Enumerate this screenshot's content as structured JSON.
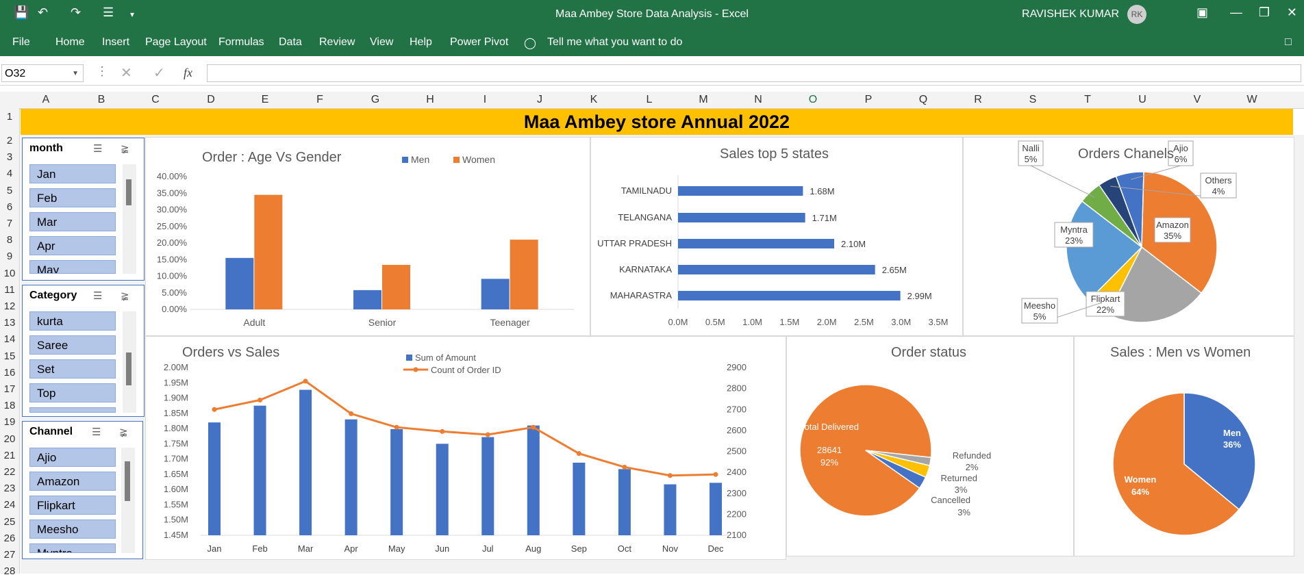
{
  "app": {
    "window_title": "Maa Ambey Store Data Analysis  -  Excel",
    "user_name": "RAVISHEK KUMAR",
    "user_initials": "RK"
  },
  "menu": [
    "File",
    "Home",
    "Insert",
    "Page Layout",
    "Formulas",
    "Data",
    "Review",
    "View",
    "Help",
    "Power Pivot",
    "Tell me what you want to do"
  ],
  "formula_bar": {
    "name_box": "O32",
    "fx_label": "fx",
    "formula": ""
  },
  "columns": [
    "A",
    "B",
    "C",
    "D",
    "E",
    "F",
    "G",
    "H",
    "I",
    "J",
    "K",
    "L",
    "M",
    "N",
    "O",
    "P",
    "Q",
    "R",
    "S",
    "T",
    "U",
    "V",
    "W"
  ],
  "rows": [
    "1",
    "2",
    "3",
    "4",
    "5",
    "6",
    "7",
    "8",
    "9",
    "10",
    "11",
    "12",
    "13",
    "14",
    "15",
    "16",
    "17",
    "18",
    "19",
    "20",
    "21",
    "22",
    "23",
    "24",
    "25",
    "26",
    "27",
    "28"
  ],
  "banner": "Maa Ambey store Annual 2022",
  "slicers": {
    "month": {
      "title": "month",
      "items": [
        "Jan",
        "Feb",
        "Mar",
        "Apr",
        "May"
      ]
    },
    "category": {
      "title": "Category",
      "items": [
        "kurta",
        "Saree",
        "Set",
        "Top",
        ""
      ]
    },
    "channel": {
      "title": "Channel",
      "items": [
        "Ajio",
        "Amazon",
        "Flipkart",
        "Meesho",
        "Myntra"
      ]
    }
  },
  "chart_data": [
    {
      "type": "bar",
      "title": "Order : Age Vs Gender",
      "categories": [
        "Adult",
        "Senior",
        "Teenager"
      ],
      "series": [
        {
          "name": "Men",
          "values": [
            0.155,
            0.058,
            0.092
          ]
        },
        {
          "name": "Women",
          "values": [
            0.345,
            0.134,
            0.21
          ]
        }
      ],
      "yticks": [
        "0.00%",
        "5.00%",
        "10.00%",
        "15.00%",
        "20.00%",
        "25.00%",
        "30.00%",
        "35.00%",
        "40.00%"
      ],
      "ylim": [
        0,
        0.4
      ],
      "legend": "top"
    },
    {
      "type": "bar",
      "orientation": "horizontal",
      "title": "Sales top 5 states",
      "categories": [
        "TAMILNADU",
        "TELANGANA",
        "UTTAR PRADESH",
        "KARNATAKA",
        "MAHARASTRA"
      ],
      "values": [
        1.68,
        1.71,
        2.1,
        2.65,
        2.99
      ],
      "labels": [
        "1.68M",
        "1.71M",
        "2.10M",
        "2.65M",
        "2.99M"
      ],
      "xticks": [
        "0.0M",
        "0.5M",
        "1.0M",
        "1.5M",
        "2.0M",
        "2.5M",
        "3.0M",
        "3.5M"
      ],
      "xlim": [
        0,
        3.5
      ]
    },
    {
      "type": "pie",
      "title": "Orders Chanels",
      "slices": [
        {
          "label": "Ajio",
          "pct": "6%",
          "value": 6,
          "color": "#4472c4"
        },
        {
          "label": "Amazon",
          "pct": "35%",
          "value": 35,
          "color": "#ed7d31"
        },
        {
          "label": "Flipkart",
          "pct": "22%",
          "value": 22,
          "color": "#a5a5a5"
        },
        {
          "label": "Meesho",
          "pct": "5%",
          "value": 5,
          "color": "#ffc000"
        },
        {
          "label": "Myntra",
          "pct": "23%",
          "value": 23,
          "color": "#5b9bd5"
        },
        {
          "label": "Nalli",
          "pct": "5%",
          "value": 5,
          "color": "#70ad47"
        },
        {
          "label": "Others",
          "pct": "4%",
          "value": 4,
          "color": "#264478"
        }
      ]
    },
    {
      "type": "bar+line",
      "title": "Orders vs Sales",
      "categories": [
        "Jan",
        "Feb",
        "Mar",
        "Apr",
        "May",
        "Jun",
        "Jul",
        "Aug",
        "Sep",
        "Oct",
        "Nov",
        "Dec"
      ],
      "series": [
        {
          "name": "Sum of Amount",
          "type": "bar",
          "axis": "left",
          "values": [
            1.82,
            1.875,
            1.927,
            1.83,
            1.798,
            1.75,
            1.772,
            1.81,
            1.688,
            1.667,
            1.617,
            1.622
          ]
        },
        {
          "name": "Count of Order ID",
          "type": "line",
          "axis": "right",
          "values": [
            2700,
            2745,
            2835,
            2680,
            2615,
            2595,
            2580,
            2615,
            2490,
            2425,
            2385,
            2390
          ]
        }
      ],
      "yticks_left": [
        "1.45M",
        "1.50M",
        "1.55M",
        "1.60M",
        "1.65M",
        "1.70M",
        "1.75M",
        "1.80M",
        "1.85M",
        "1.90M",
        "1.95M",
        "2.00M"
      ],
      "ylim_left": [
        1.45,
        2.0
      ],
      "yticks_right": [
        "2100",
        "2200",
        "2300",
        "2400",
        "2500",
        "2600",
        "2700",
        "2800",
        "2900"
      ],
      "ylim_right": [
        2100,
        2900
      ]
    },
    {
      "type": "pie",
      "title": "Order status",
      "slices": [
        {
          "label": "Total Delivered",
          "count": "28641",
          "pct": "92%",
          "value": 92,
          "color": "#ed7d31"
        },
        {
          "label": "Refunded",
          "pct": "2%",
          "value": 2,
          "color": "#a5a5a5"
        },
        {
          "label": "Returned",
          "pct": "3%",
          "value": 3,
          "color": "#ffc000"
        },
        {
          "label": "Cancelled",
          "pct": "3%",
          "value": 3,
          "color": "#4472c4"
        }
      ]
    },
    {
      "type": "pie",
      "title": "Sales : Men vs Women",
      "slices": [
        {
          "label": "Men",
          "pct": "36%",
          "value": 36,
          "color": "#4472c4"
        },
        {
          "label": "Women",
          "pct": "64%",
          "value": 64,
          "color": "#ed7d31"
        }
      ]
    }
  ]
}
